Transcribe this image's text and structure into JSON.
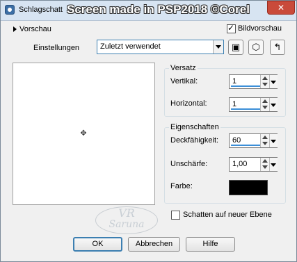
{
  "window": {
    "title": "Schlagschatt",
    "watermark": "Screen made in PSP2018 ©Corel",
    "close_glyph": "✕"
  },
  "top": {
    "preview_toggle": "Vorschau",
    "preview_checkbox_label": "Bildvorschau",
    "preview_checked": true,
    "settings_label": "Einstellungen",
    "settings_value": "Zuletzt verwendet",
    "tool_icons": [
      "save-icon",
      "reset-icon",
      "load-icon"
    ]
  },
  "offset": {
    "title": "Versatz",
    "vertical_label": "Vertikal:",
    "vertical_value": "1",
    "horizontal_label": "Horizontal:",
    "horizontal_value": "1"
  },
  "properties": {
    "title": "Eigenschaften",
    "opacity_label": "Deckfähigkeit:",
    "opacity_value": "60",
    "blur_label": "Unschärfe:",
    "blur_value": "1,00",
    "color_label": "Farbe:",
    "color_value": "#000000"
  },
  "new_layer": {
    "label": "Schatten auf neuer Ebene",
    "checked": false
  },
  "logo": {
    "line1": "VR",
    "line2": "Saruna"
  },
  "buttons": {
    "ok": "OK",
    "cancel": "Abbrechen",
    "help": "Hilfe"
  }
}
